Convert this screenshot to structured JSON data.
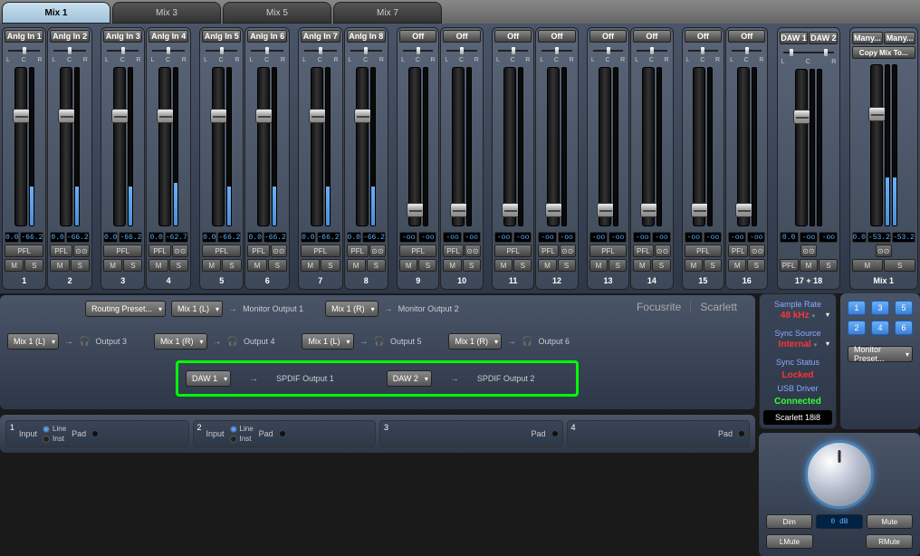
{
  "tabs": [
    {
      "label": "Mix 1",
      "active": true
    },
    {
      "label": "Mix 3",
      "active": false
    },
    {
      "label": "Mix 5",
      "active": false
    },
    {
      "label": "Mix 7",
      "active": false
    }
  ],
  "channels": [
    {
      "label": "Anlg In 1",
      "val": "0.0",
      "meter": "-66.2",
      "num": "1",
      "fpos": 65,
      "mfill": 25,
      "buttons": [
        "PFL"
      ],
      "mss": [
        "M",
        "S"
      ]
    },
    {
      "label": "Anlg In 2",
      "val": "0.0",
      "meter": "-66.2",
      "num": "2",
      "fpos": 65,
      "mfill": 25,
      "buttons": [
        "PFL"
      ],
      "mss": [
        "M",
        "S"
      ]
    },
    {
      "label": "Anlg In 3",
      "val": "0.0",
      "meter": "-66.2",
      "num": "3",
      "fpos": 65,
      "mfill": 25,
      "buttons": [
        "PFL"
      ],
      "mss": [
        "M",
        "S"
      ]
    },
    {
      "label": "Anlg In 4",
      "val": "0.0",
      "meter": "-62.7",
      "num": "4",
      "fpos": 65,
      "mfill": 27,
      "buttons": [
        "PFL"
      ],
      "mss": [
        "M",
        "S"
      ]
    },
    {
      "label": "Anlg In 5",
      "val": "0.0",
      "meter": "-66.2",
      "num": "5",
      "fpos": 65,
      "mfill": 25,
      "buttons": [
        "PFL"
      ],
      "mss": [
        "M",
        "S"
      ]
    },
    {
      "label": "Anlg In 6",
      "val": "0.0",
      "meter": "-66.2",
      "num": "6",
      "fpos": 65,
      "mfill": 25,
      "buttons": [
        "PFL"
      ],
      "mss": [
        "M",
        "S"
      ]
    },
    {
      "label": "Anlg In 7",
      "val": "0.0",
      "meter": "-66.2",
      "num": "7",
      "fpos": 65,
      "mfill": 25,
      "buttons": [
        "PFL"
      ],
      "mss": [
        "M",
        "S"
      ]
    },
    {
      "label": "Anlg In 8",
      "val": "0.0",
      "meter": "-66.2",
      "num": "8",
      "fpos": 65,
      "mfill": 25,
      "buttons": [
        "PFL"
      ],
      "mss": [
        "M",
        "S"
      ]
    },
    {
      "label": "Off",
      "val": "-oo",
      "meter": "-oo",
      "num": "9",
      "fpos": 5,
      "mfill": 0,
      "buttons": [
        "PFL"
      ],
      "mss": [
        "M",
        "S"
      ]
    },
    {
      "label": "Off",
      "val": "-oo",
      "meter": "-oo",
      "num": "10",
      "fpos": 5,
      "mfill": 0,
      "buttons": [
        "PFL"
      ],
      "mss": [
        "M",
        "S"
      ]
    },
    {
      "label": "Off",
      "val": "-oo",
      "meter": "-oo",
      "num": "11",
      "fpos": 5,
      "mfill": 0,
      "buttons": [
        "PFL"
      ],
      "mss": [
        "M",
        "S"
      ]
    },
    {
      "label": "Off",
      "val": "-oo",
      "meter": "-oo",
      "num": "12",
      "fpos": 5,
      "mfill": 0,
      "buttons": [
        "PFL"
      ],
      "mss": [
        "M",
        "S"
      ]
    },
    {
      "label": "Off",
      "val": "-oo",
      "meter": "-oo",
      "num": "13",
      "fpos": 5,
      "mfill": 0,
      "buttons": [
        "PFL"
      ],
      "mss": [
        "M",
        "S"
      ]
    },
    {
      "label": "Off",
      "val": "-oo",
      "meter": "-oo",
      "num": "14",
      "fpos": 5,
      "mfill": 0,
      "buttons": [
        "PFL"
      ],
      "mss": [
        "M",
        "S"
      ]
    },
    {
      "label": "Off",
      "val": "-oo",
      "meter": "-oo",
      "num": "15",
      "fpos": 5,
      "mfill": 0,
      "buttons": [
        "PFL"
      ],
      "mss": [
        "M",
        "S"
      ]
    },
    {
      "label": "Off",
      "val": "-oo",
      "meter": "-oo",
      "num": "16",
      "fpos": 5,
      "mfill": 0,
      "buttons": [
        "PFL"
      ],
      "mss": [
        "M",
        "S"
      ]
    }
  ],
  "stereo_channel": {
    "label1": "DAW 1",
    "label2": "DAW 2",
    "val": "0.0",
    "meter": "-oo",
    "num": "17 + 18",
    "fpos": 65,
    "mfill": 0
  },
  "master": {
    "label1": "Many...",
    "label2": "Many...",
    "copy": "Copy Mix To...",
    "val": "0.0",
    "meter1": "-53.2",
    "meter2": "-53.2",
    "num": "Mix 1",
    "fpos": 65,
    "mfill": 30
  },
  "pfl_label": "PFL",
  "link_icon": "⊙⊙",
  "m": "M",
  "s": "S",
  "routing": {
    "preset_btn": "Routing Preset...",
    "row1": [
      {
        "dd": "Mix 1 (L)",
        "arrow": "→",
        "label": "Monitor Output 1"
      },
      {
        "dd": "Mix 1 (R)",
        "arrow": "→",
        "label": "Monitor Output 2"
      }
    ],
    "row2": [
      {
        "dd": "Mix 1 (L)",
        "arrow": "→",
        "label": "Output 3",
        "hp": true
      },
      {
        "dd": "Mix 1 (R)",
        "arrow": "→",
        "label": "Output 4",
        "hp": true
      },
      {
        "dd": "Mix 1 (L)",
        "arrow": "→",
        "label": "Output 5",
        "hp": true
      },
      {
        "dd": "Mix 1 (R)",
        "arrow": "→",
        "label": "Output 6",
        "hp": true
      }
    ],
    "row3": [
      {
        "dd": "DAW 1",
        "arrow": "→",
        "label": "SPDIF Output 1"
      },
      {
        "dd": "DAW 2",
        "arrow": "→",
        "label": "SPDIF Output 2"
      }
    ]
  },
  "brand": {
    "a": "Focusrite",
    "b": "Scarlett"
  },
  "status": {
    "sample_rate_label": "Sample Rate",
    "sample_rate": "48 kHz",
    "sync_source_label": "Sync Source",
    "sync_source": "Internal",
    "sync_status_label": "Sync Status",
    "sync_status": "Locked",
    "usb_label": "USB  Driver",
    "usb": "Connected",
    "device": "Scarlett 18i8"
  },
  "monitor": {
    "buttons": [
      "1",
      "3",
      "5",
      "2",
      "4",
      "6"
    ],
    "preset_btn": "Monitor Preset...",
    "dim": "Dim",
    "db": "0 dB",
    "mute": "Mute",
    "lmute": "LMute",
    "rmute": "RMute"
  },
  "inputs": {
    "label": "Input",
    "line": "Line",
    "inst": "Inst",
    "pad": "Pad",
    "blocks": [
      {
        "num": "1",
        "radio": true
      },
      {
        "num": "2",
        "radio": true
      },
      {
        "num": "3",
        "radio": false
      },
      {
        "num": "4",
        "radio": false
      }
    ]
  },
  "pan": {
    "L": "L",
    "C": "C",
    "R": "R"
  }
}
